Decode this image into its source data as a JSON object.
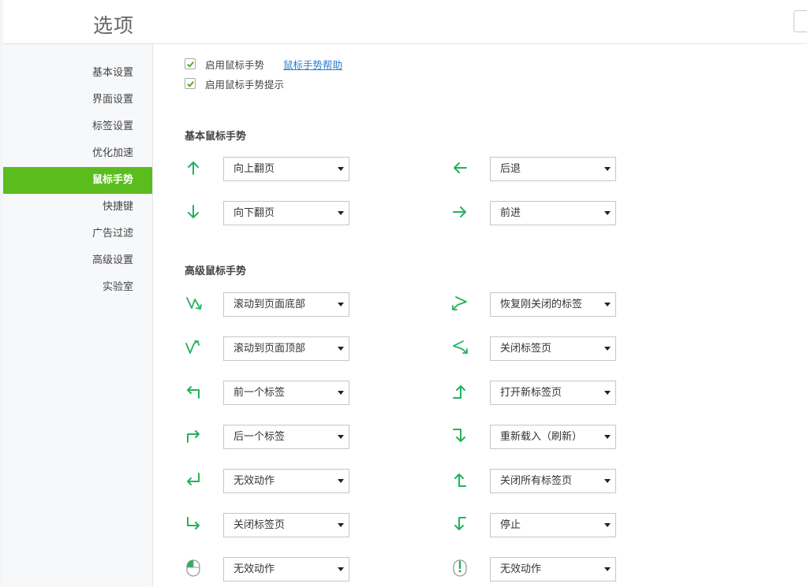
{
  "header": {
    "title": "选项"
  },
  "sidebar": {
    "items": [
      {
        "label": "基本设置"
      },
      {
        "label": "界面设置"
      },
      {
        "label": "标签设置"
      },
      {
        "label": "优化加速"
      },
      {
        "label": "鼠标手势",
        "active": true
      },
      {
        "label": "快捷键"
      },
      {
        "label": "广告过滤"
      },
      {
        "label": "高级设置"
      },
      {
        "label": "实验室"
      }
    ]
  },
  "options": {
    "enable_gesture": {
      "label": "启用鼠标手势",
      "checked": true
    },
    "help_link": "鼠标手势帮助",
    "enable_hint": {
      "label": "启用鼠标手势提示",
      "checked": true
    }
  },
  "basic_section": {
    "title": "基本鼠标手势",
    "gestures": [
      {
        "icon": "arrow-up-icon",
        "value": "向上翻页"
      },
      {
        "icon": "arrow-left-icon",
        "value": "后退"
      },
      {
        "icon": "arrow-down-icon",
        "value": "向下翻页"
      },
      {
        "icon": "arrow-right-icon",
        "value": "前进"
      }
    ]
  },
  "advanced_section": {
    "title": "高级鼠标手势",
    "gestures": [
      {
        "icon": "up-down-gesture-icon",
        "value": "滚动到页面底部"
      },
      {
        "icon": "right-left-gesture-icon",
        "value": "恢复刚关闭的标签"
      },
      {
        "icon": "down-up-gesture-icon",
        "value": "滚动到页面顶部"
      },
      {
        "icon": "left-right-gesture-icon",
        "value": "关闭标签页"
      },
      {
        "icon": "up-left-gesture-icon",
        "value": "前一个标签"
      },
      {
        "icon": "left-up-gesture-icon",
        "value": "打开新标签页"
      },
      {
        "icon": "up-right-gesture-icon",
        "value": "后一个标签"
      },
      {
        "icon": "right-down-gesture-icon",
        "value": "重新载入（刷新）"
      },
      {
        "icon": "down-left-gesture-icon",
        "value": "无效动作"
      },
      {
        "icon": "right-up-gesture-icon",
        "value": "关闭所有标签页"
      },
      {
        "icon": "down-right-gesture-icon",
        "value": "关闭标签页"
      },
      {
        "icon": "left-down-gesture-icon",
        "value": "停止"
      },
      {
        "icon": "mouse-left-right-click-icon",
        "value": "无效动作"
      },
      {
        "icon": "mouse-wheel-click-icon",
        "value": "无效动作"
      }
    ]
  },
  "colors": {
    "accent": "#5abd1d",
    "icon": "#22b35b",
    "link": "#2a7bd0"
  }
}
